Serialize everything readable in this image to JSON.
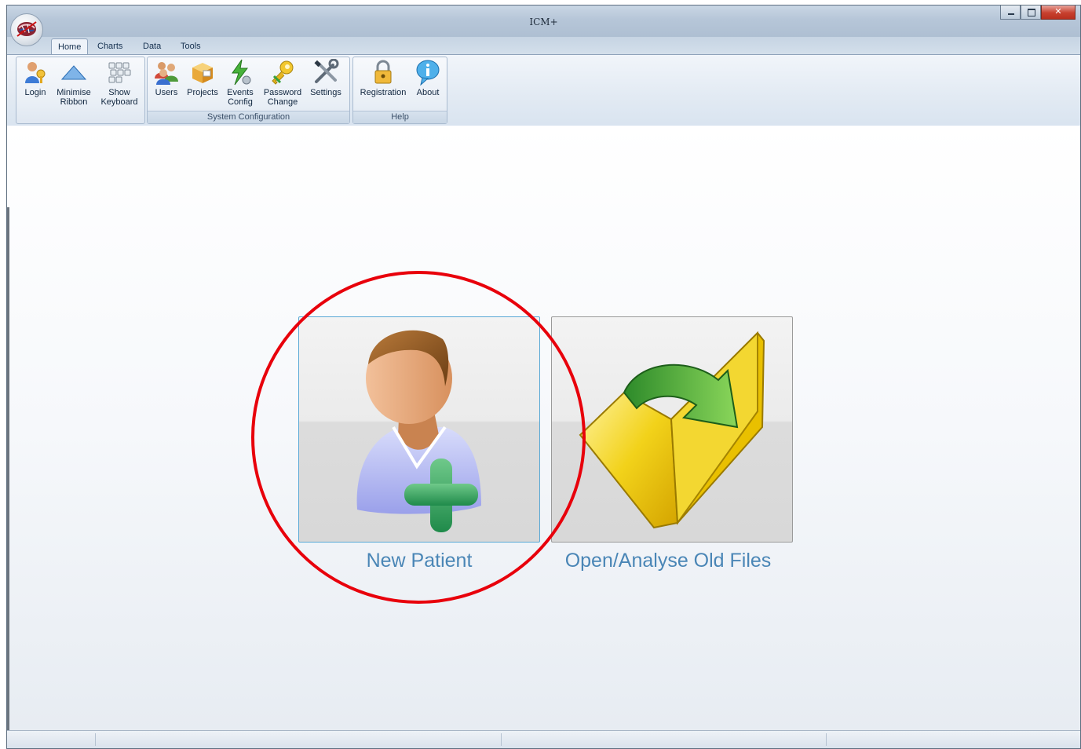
{
  "window": {
    "title": "ICM+"
  },
  "ribbon_tabs": [
    {
      "label": "Home",
      "active": true
    },
    {
      "label": "Charts",
      "active": false
    },
    {
      "label": "Data",
      "active": false
    },
    {
      "label": "Tools",
      "active": false
    }
  ],
  "groups": {
    "general": {
      "label": "",
      "buttons": [
        {
          "label": "Login",
          "icon": "login-key-icon"
        },
        {
          "label": "Minimise\nRibbon",
          "icon": "triangle-up-icon"
        },
        {
          "label": "Show\nKeyboard",
          "icon": "keyboard-icon"
        }
      ]
    },
    "system": {
      "label": "System Configuration",
      "buttons": [
        {
          "label": "Users",
          "icon": "users-icon"
        },
        {
          "label": "Projects",
          "icon": "projects-box-icon"
        },
        {
          "label": "Events\nConfig",
          "icon": "events-lightning-icon"
        },
        {
          "label": "Password\nChange",
          "icon": "password-key-icon"
        },
        {
          "label": "Settings",
          "icon": "tools-icon"
        }
      ]
    },
    "help": {
      "label": "Help",
      "buttons": [
        {
          "label": "Registration",
          "icon": "padlock-icon"
        },
        {
          "label": "About",
          "icon": "info-bubble-icon"
        }
      ]
    }
  },
  "main": {
    "new_patient": {
      "label": "New Patient",
      "icon": "patient-add-icon"
    },
    "open_files": {
      "label": "Open/Analyse Old Files",
      "icon": "folder-open-arrow-icon"
    }
  },
  "colors": {
    "highlight": "#e8000b",
    "caption": "#4a86b6",
    "tile_selected_border": "#5aa9d6"
  }
}
